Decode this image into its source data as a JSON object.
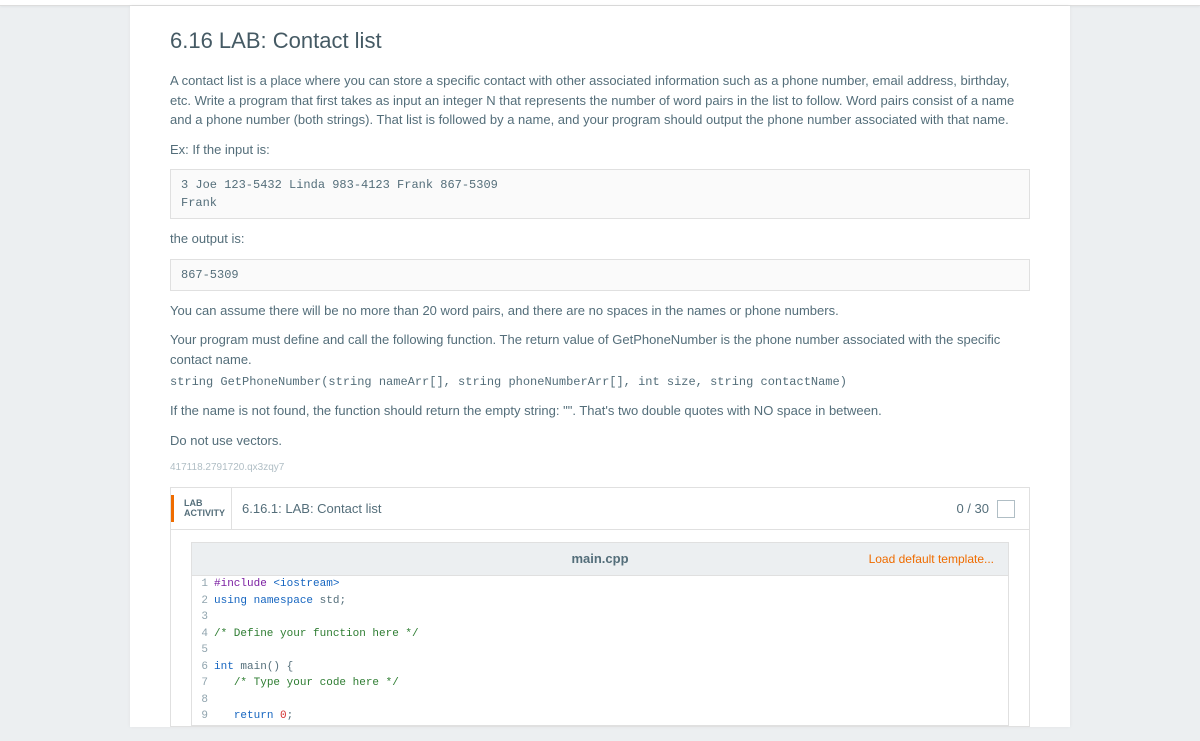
{
  "title": "6.16 LAB: Contact list",
  "intro": "A contact list is a place where you can store a specific contact with other associated information such as a phone number, email address, birthday, etc. Write a program that first takes as input an integer N that represents the number of word pairs in the list to follow. Word pairs consist of a name and a phone number (both strings). That list is followed by a name, and your program should output the phone number associated with that name.",
  "ex_label": "Ex: If the input is:",
  "example_input": "3 Joe 123-5432 Linda 983-4123 Frank 867-5309\nFrank",
  "output_label": "the output is:",
  "example_output": "867-5309",
  "assume_text": "You can assume there will be no more than 20 word pairs, and there are no spaces in the names or phone numbers.",
  "func_intro": "Your program must define and call the following function. The return value of GetPhoneNumber is the phone number associated with the specific contact name.",
  "func_sig": "string GetPhoneNumber(string nameArr[], string phoneNumberArr[], int size, string contactName)",
  "notfound_text": "If the name is not found, the function should return the empty string: \"\". That's two double quotes with NO space in between.",
  "no_vectors": "Do not use vectors.",
  "tiny_id": "417118.2791720.qx3zqy7",
  "activity": {
    "badge_line1": "LAB",
    "badge_line2": "ACTIVITY",
    "title": "6.16.1: LAB: Contact list",
    "score": "0 / 30"
  },
  "editor": {
    "filename": "main.cpp",
    "load_template": "Load default template...",
    "lines": [
      {
        "n": 1,
        "html": "<span class='kw-macro'>#include</span> <span class='kw-str'>&lt;iostream&gt;</span>"
      },
      {
        "n": 2,
        "html": "<span class='kw-blue'>using</span> <span class='kw-blue'>namespace</span> std;"
      },
      {
        "n": 3,
        "html": ""
      },
      {
        "n": 4,
        "html": "<span class='kw-comment'>/* Define your function here */</span>"
      },
      {
        "n": 5,
        "html": ""
      },
      {
        "n": 6,
        "html": "<span class='kw-type'>int</span> main() {"
      },
      {
        "n": 7,
        "html": "   <span class='kw-comment'>/* Type your code here */</span>"
      },
      {
        "n": 8,
        "html": ""
      },
      {
        "n": 9,
        "html": "   <span class='kw-blue'>return</span> <span class='kw-num'>0</span>;"
      }
    ]
  }
}
